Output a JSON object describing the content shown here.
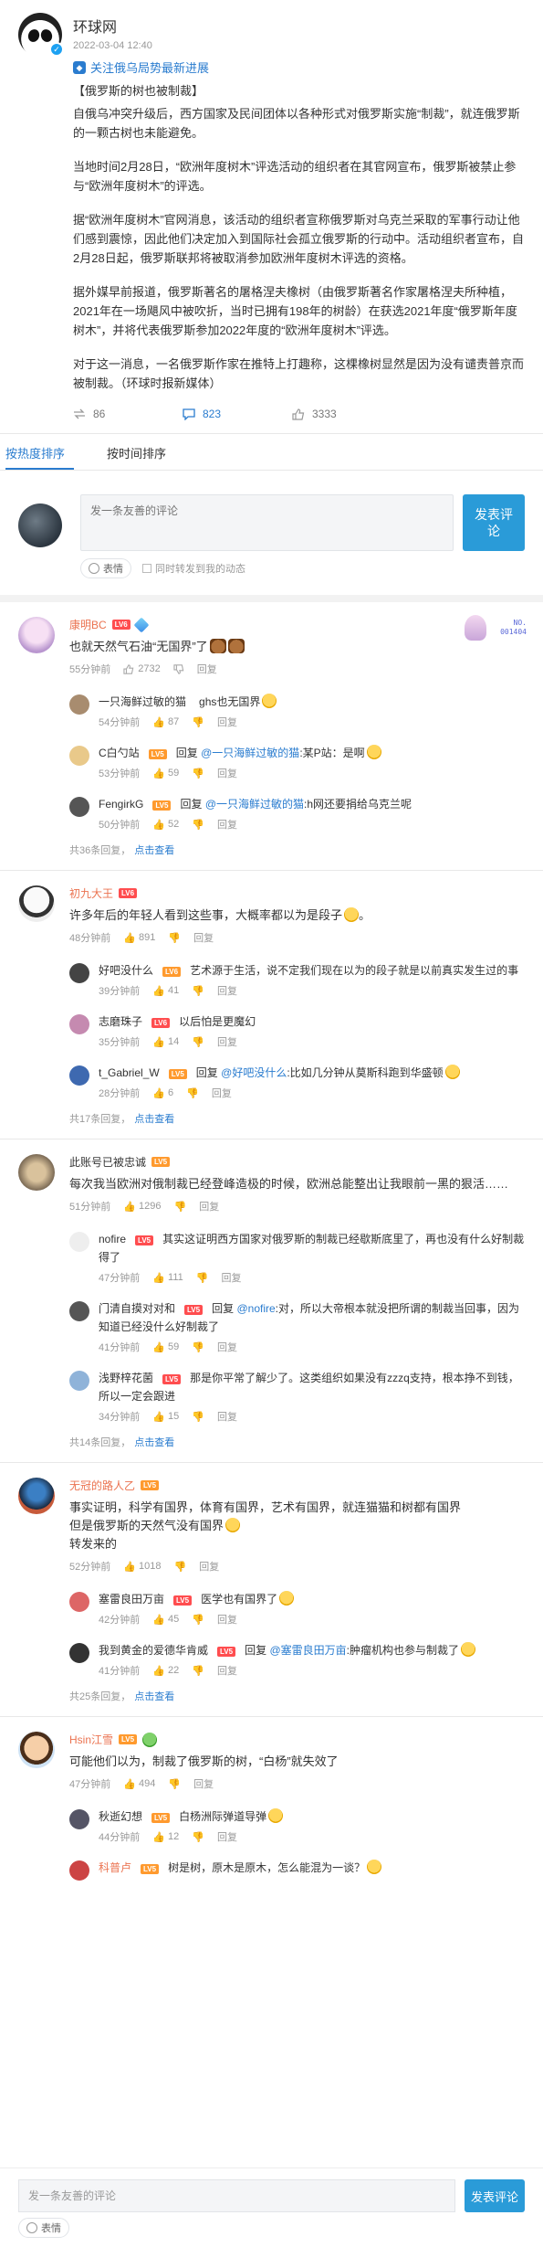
{
  "post": {
    "author": "环球网",
    "time": "2022-03-04 12:40",
    "topic": "关注俄乌局势最新进展",
    "paragraphs": [
      "【俄罗斯的树也被制裁】",
      "自俄乌冲突升级后，西方国家及民间团体以各种形式对俄罗斯实施“制裁”，就连俄罗斯的一颗古树也未能避免。",
      "当地时间2月28日，“欧洲年度树木”评选活动的组织者在其官网宣布，俄罗斯被禁止参与“欧洲年度树木”的评选。",
      "据“欧洲年度树木”官网消息，该活动的组织者宣称俄罗斯对乌克兰采取的军事行动让他们感到震惊，因此他们决定加入到国际社会孤立俄罗斯的行动中。活动组织者宣布，自2月28日起，俄罗斯联邦将被取消参加欧洲年度树木评选的资格。",
      "据外媒早前报道，俄罗斯著名的屠格涅夫橡树（由俄罗斯著名作家屠格涅夫所种植，2021年在一场飓风中被吹折，当时已拥有198年的树龄）在获选2021年度“俄罗斯年度树木”，并将代表俄罗斯参加2022年度的“欧洲年度树木”评选。",
      "对于这一消息，一名俄罗斯作家在推特上打趣称，这棵橡树显然是因为没有谴责普京而被制裁。（环球时报新媒体）"
    ],
    "reposts": "86",
    "comments": "823",
    "likes": "3333"
  },
  "tabs": [
    "按热度排序",
    "按时间排序"
  ],
  "compose": {
    "placeholder": "发一条友善的评论",
    "submit": "发表评论",
    "emoji": "表情",
    "also_repost": "同时转发到我的动态"
  },
  "bottom_compose": {
    "placeholder": "发一条友善的评论",
    "submit": "发表评论",
    "emoji": "表情"
  },
  "ui": {
    "reply": "回复",
    "reply_prefix": "回复",
    "see_more": "点击查看"
  },
  "c1": {
    "name": "康明BC",
    "lv": "LV6",
    "text": "也就天然气石油“无国界”了",
    "time": "55分钟前",
    "likes": "2732",
    "badge_no": "NO.",
    "badge_num": "001404",
    "replies": [
      {
        "name": "一只海鲜过敏的猫",
        "lv": "",
        "text": "ghs也无国界",
        "time": "54分钟前",
        "likes": "87"
      },
      {
        "name": "C白勺站",
        "lv": "LV5",
        "at": "@一只海鲜过敏的猫",
        "text": ":某P站：是啊",
        "time": "53分钟前",
        "likes": "59"
      },
      {
        "name": "FengirkG",
        "lv": "LV5",
        "at": "@一只海鲜过敏的猫",
        "text": ":h网还要捐给乌克兰呢",
        "time": "50分钟前",
        "likes": "52"
      }
    ],
    "more": "共36条回复，"
  },
  "c2": {
    "name": "初九大王",
    "lv": "LV6",
    "text": "许多年后的年轻人看到这些事，大概率都以为是段子",
    "time": "48分钟前",
    "likes": "891",
    "replies": [
      {
        "name": "好吧没什么",
        "lv": "LV6",
        "text": "艺术源于生活，说不定我们现在以为的段子就是以前真实发生过的事",
        "time": "39分钟前",
        "likes": "41"
      },
      {
        "name": "志磨珠子",
        "lv": "LV6",
        "text": "以后怕是更魔幻",
        "time": "35分钟前",
        "likes": "14"
      },
      {
        "name": "t_Gabriel_W",
        "lv": "LV5",
        "at": "@好吧没什么",
        "text": ":比如几分钟从莫斯科跑到华盛顿",
        "time": "28分钟前",
        "likes": "6"
      }
    ],
    "more": "共17条回复，"
  },
  "c3": {
    "name": "此账号已被忠诚",
    "lv": "LV5",
    "text": "每次我当欧洲对俄制裁已经登峰造极的时候，欧洲总能整出让我眼前一黑的狠活……",
    "time": "51分钟前",
    "likes": "1296",
    "replies": [
      {
        "name": "nofire",
        "lv": "LV5",
        "text": "其实这证明西方国家对俄罗斯的制裁已经歇斯底里了，再也没有什么好制裁得了",
        "time": "47分钟前",
        "likes": "111"
      },
      {
        "name": "门清自摸对对和",
        "lv": "LV5",
        "at": "@nofire",
        "text": ":对，所以大帝根本就没把所谓的制裁当回事，因为知道已经没什么好制裁了",
        "time": "41分钟前",
        "likes": "59"
      },
      {
        "name": "浅野梓花菌",
        "lv": "LV5",
        "text": "那是你平常了解少了。这类组织如果没有zzzq支持，根本挣不到钱，所以一定会跟进",
        "time": "34分钟前",
        "likes": "15"
      }
    ],
    "more": "共14条回复，"
  },
  "c4": {
    "name": "无冠的路人乙",
    "lv": "LV5",
    "text": "事实证明，科学有国界，体育有国界，艺术有国界，就连猫猫和树都有国界",
    "text2": "但是俄罗斯的天然气没有国界",
    "text3": "转发来的",
    "time": "52分钟前",
    "likes": "1018",
    "replies": [
      {
        "name": "塞雷良田万亩",
        "lv": "LV5",
        "text": "医学也有国界了",
        "time": "42分钟前",
        "likes": "45"
      },
      {
        "name": "我到黄金的爱德华肯威",
        "lv": "LV5",
        "at": "@塞雷良田万亩",
        "text": ":肿瘤机构也参与制裁了",
        "time": "41分钟前",
        "likes": "22"
      }
    ],
    "more": "共25条回复，"
  },
  "c5": {
    "name": "Hsin江雪",
    "lv": "LV5",
    "text": "可能他们以为，制裁了俄罗斯的树，“白杨”就失效了",
    "time": "47分钟前",
    "likes": "494",
    "replies": [
      {
        "name": "秋逝幻想",
        "lv": "LV5",
        "text": "白杨洲际弹道导弹",
        "time": "44分钟前",
        "likes": "12"
      },
      {
        "name": "科普卢",
        "lv": "LV5",
        "text": "树是树，原木是原木，怎么能混为一谈？",
        "time": "",
        "likes": ""
      }
    ]
  },
  "colors": {
    "accent": "#2a7ccf",
    "button": "#2a9bd8",
    "name": "#eb7350",
    "level": "#ff4d4f"
  }
}
